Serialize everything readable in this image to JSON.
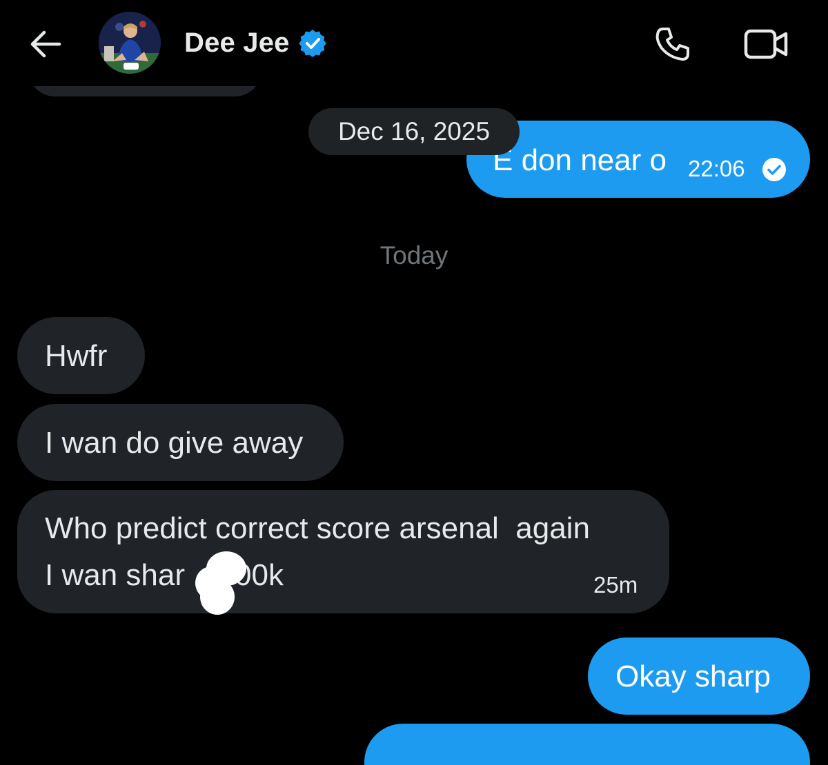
{
  "header": {
    "contact_name": "Dee Jee",
    "verified": true,
    "icons": {
      "back": "arrow-left-icon",
      "verified": "verified-badge-icon",
      "call": "phone-icon",
      "video": "video-camera-icon"
    }
  },
  "colors": {
    "background": "#000000",
    "outgoing_bubble": "#1d9bf0",
    "incoming_bubble": "#202327",
    "muted_text": "#71767b"
  },
  "conversation": {
    "date_chip": "Dec 16, 2025",
    "day_separator": "Today",
    "messages": [
      {
        "direction": "outgoing",
        "text": "E don near o",
        "time": "22:06",
        "read": true
      },
      {
        "direction": "incoming",
        "text": "Hwfr"
      },
      {
        "direction": "incoming",
        "text": "I wan do give away"
      },
      {
        "direction": "incoming",
        "lines": [
          "Who predict correct score arsenal  again",
          "I wan shar",
          "00k"
        ],
        "time": "25m"
      },
      {
        "direction": "outgoing",
        "text": "Okay sharp"
      }
    ]
  }
}
